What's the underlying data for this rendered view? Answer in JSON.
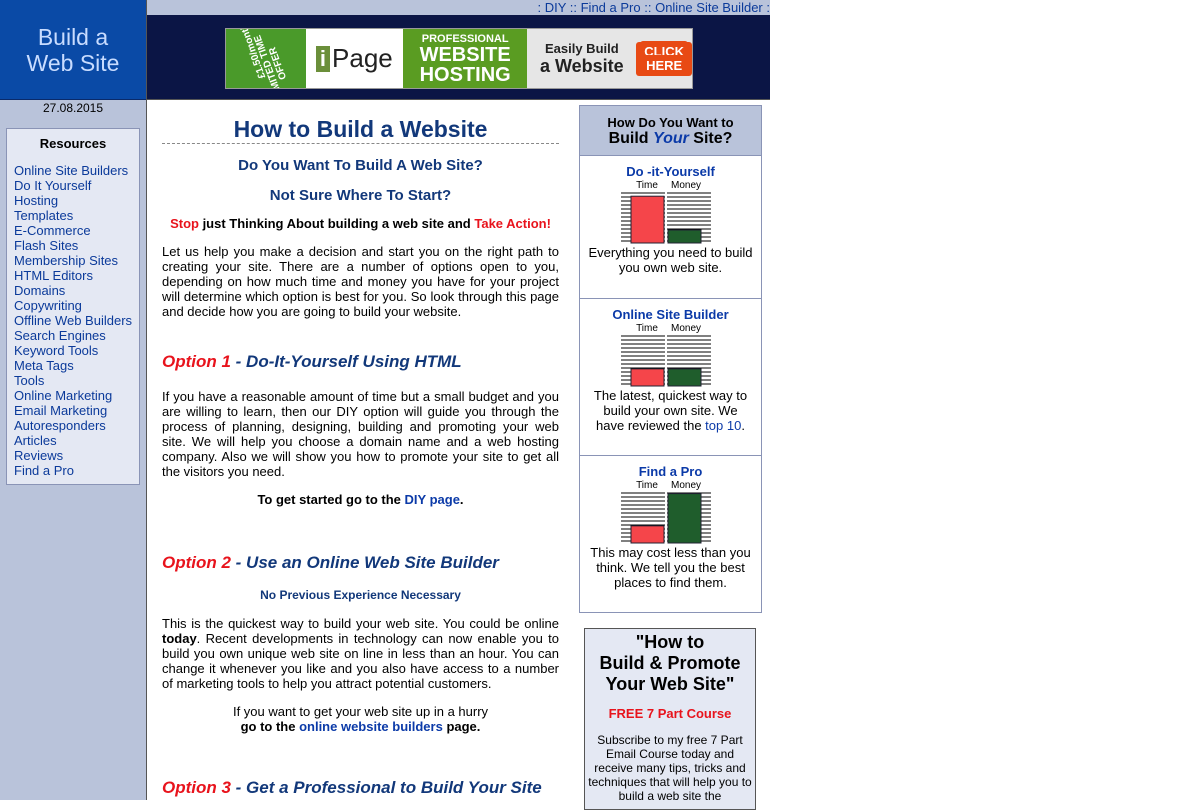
{
  "left": {
    "logo_line1": "Build a",
    "logo_line2": "Web Site",
    "date": "27.08.2015",
    "resources_title": "Resources",
    "resources": [
      "Online Site Builders",
      "Do It Yourself",
      "Hosting",
      "Templates",
      "E-Commerce",
      "Flash Sites",
      "Membership Sites",
      "HTML Editors",
      "Domains",
      "Copywriting",
      "Offline Web Builders",
      "Search Engines",
      "Keyword Tools",
      "Meta Tags",
      "Tools",
      "Online Marketing",
      "Email Marketing",
      "Autoresponders",
      "Articles",
      "Reviews",
      "Find a Pro"
    ]
  },
  "topnav": {
    "sep": ":",
    "dsep": "::",
    "diy": "DIY",
    "pro": "Find a Pro",
    "builder": "Online Site Builder"
  },
  "ad": {
    "price": "£1.50/month",
    "offer": "LIMITED TIME OFFER",
    "brand_i": "i",
    "brand_rest": "Page",
    "pro1": "PROFESSIONAL",
    "pro2": "WEBSITE",
    "pro3": "HOSTING",
    "easy1": "Easily Build",
    "easy2": "a Website",
    "click1": "CLICK",
    "click2": "HERE"
  },
  "main": {
    "title": "How to Build a Website",
    "sub1": "Do You Want To Build A Web Site?",
    "sub2": "Not Sure Where To Start?",
    "stop": "Stop",
    "stop_mid": " just Thinking About building a web site and ",
    "take_action": "Take Action!",
    "intro": "Let us help you make a decision and start you on the right path to creating your site.  There are a number of options open to you, depending on how much time and money you have for your project will determine which option is best for you. So look through this page and decide how you are going to build your website.",
    "opt1_label": "Option 1",
    "opt1_title": " - Do-It-Yourself Using HTML",
    "opt1_text": "If you have a reasonable amount of time but a small budget and you are willing to learn, then our DIY option will guide you through the process of planning, designing, building and promoting your web site. We will help you choose a domain name and a web hosting company.  Also we will show you how to promote your site to get all the visitors you need.",
    "opt1_cta_pre": "To get started go to the ",
    "opt1_cta_link": "DIY page",
    "opt1_cta_post": ".",
    "opt2_label": "Option 2",
    "opt2_title": " - Use an Online Web Site Builder",
    "opt2_sub": "No Previous Experience Necessary",
    "opt2_text_a": "This is the quickest way to build your web site.  You could be online ",
    "opt2_text_b": "today",
    "opt2_text_c": ".  Recent developments in technology can now enable you to build you own unique web site on line in less than an hour. You can change it whenever you like and you also have access to a number of marketing tools to help you attract potential customers.",
    "opt2_cta1": "If you want to get your web site up in a hurry",
    "opt2_cta2_pre": "go to the ",
    "opt2_cta2_link": "online website builders",
    "opt2_cta2_post": " page.",
    "opt3_label": "Option 3",
    "opt3_title": " - Get a Professional to Build Your Site"
  },
  "right": {
    "head1": "How Do You Want to",
    "head2_pre": "Build ",
    "head2_em": "Your",
    "head2_post": " Site?",
    "time_label": "Time",
    "money_label": "Money",
    "sections": [
      {
        "title": "Do -it-Yourself",
        "time": 0.9,
        "money": 0.25,
        "desc": "Everything you need to build you own web site."
      },
      {
        "title": "Online Site Builder",
        "time": 0.33,
        "money": 0.33,
        "desc_a": "The latest, quickest way to build your own site.  We have reviewed the ",
        "desc_link": "top 10",
        "desc_b": "."
      },
      {
        "title": "Find a Pro",
        "time": 0.33,
        "money": 0.95,
        "desc": "This may cost less than you think.  We tell you the best places to find them."
      }
    ]
  },
  "course": {
    "title1": "\"How to",
    "title2": "Build & Promote",
    "title3": "Your Web Site\"",
    "free": "FREE 7 Part Course",
    "desc": "Subscribe to my free 7 Part  Email Course today and receive many tips, tricks and techniques that will help you to build a web site the"
  },
  "colors": {
    "time_bar": "#f5454a",
    "money_bar": "#1f5d2c",
    "link": "#0b3aa8",
    "accent_red": "#e8131c",
    "heading_blue": "#12387a"
  }
}
